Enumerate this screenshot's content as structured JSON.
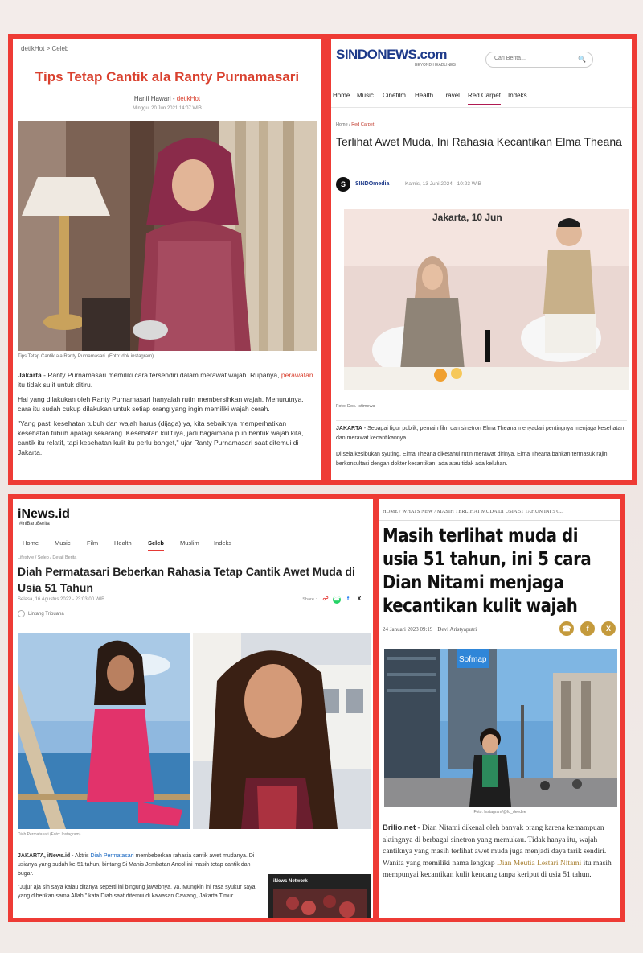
{
  "panel1": {
    "breadcrumb": "detikHot  >  Celeb",
    "title": "Tips Tetap Cantik ala Ranty Purnamasari",
    "author": "Hanif Hawari - ",
    "author_source": "detikHot",
    "date": "Minggu, 20 Jun 2021 14:07 WIB",
    "caption": "Tips Tetap Cantik ala Ranty Purnamasari. (Foto: dok instagram)",
    "p1_city": "Jakarta",
    "p1_a": " - Ranty Purnamasari memiliki cara tersendiri dalam merawat wajah. Rupanya, ",
    "p1_link": "perawatan",
    "p1_b": " itu tidak sulit untuk ditiru.",
    "p2": "Hal yang dilakukan oleh Ranty Purnamasari hanyalah rutin membersihkan wajah. Menurutnya, cara itu sudah cukup dilakukan untuk setiap orang yang ingin memiliki wajah cerah.",
    "p3": "\"Yang pasti kesehatan tubuh dan wajah harus (dijaga) ya, kita sebaiknya memperhatikan kesehatan tubuh apalagi sekarang. Kesehatan kulit iya, jadi bagaimana pun bentuk wajah kita, cantik itu relatif, tapi kesehatan kulit itu perlu banget,\" ujar Ranty Purnamasari saat ditemui di Jakarta."
  },
  "panel2": {
    "logo": "SINDONEWS.com",
    "tagline": "BEYOND HEADLINES",
    "search_placeholder": "Cari Berita...",
    "nav": [
      "Home",
      "Music",
      "Cinefilm",
      "Health",
      "Travel",
      "Red Carpet",
      "Indeks"
    ],
    "breadcrumb_home": "Home / ",
    "breadcrumb_section": "Red Carpet",
    "title": "Terlihat Awet Muda, Ini Rahasia Kecantikan Elma Theana",
    "avatar_letter": "S",
    "author": "SINDOmedia",
    "date": "Kamis, 13 Juni 2024 - 10:23 WIB",
    "photo_text": "Jakarta, 10 Jun",
    "caption": "Foto: Doc. Istimewa",
    "p1_city": "JAKARTA",
    "p1": " - Sebagai figur publik, pemain film dan sinetron Elma Theana menyadari pentingnya menjaga kesehatan dan merawat kecantikannya.",
    "p2": "Di sela kesibukan syuting, Elma Theana diketahui rutin merawat dirinya. Elma Theana bahkan termasuk rajin berkonsultasi dengan dokter kecantikan, ada atau tidak ada keluhan."
  },
  "panel3": {
    "logo": "iNews.id",
    "tag": "#iniBaruBerita",
    "nav": [
      "Home",
      "Music",
      "Film",
      "Health",
      "Seleb",
      "Muslim",
      "Indeks"
    ],
    "breadcrumb": "Lifestyle  /  Seleb  /  Detail Berita",
    "title": "Diah Permatasari Beberkan Rahasia Tetap Cantik Awet Muda di Usia 51 Tahun",
    "date": "Selasa, 16 Agustus 2022 - 23:03:00 WIB",
    "share_label": "Share :",
    "author": "Lintang Tribuana",
    "caption": "Diah Permatasari (Foto: Instagram)",
    "p1_city": "JAKARTA, iNews.id",
    "p1_a": " - Aktris ",
    "p1_link": "Diah Permatasari",
    "p1_b": " membeberkan rahasia cantik awet mudanya. Di usianya yang sudah ke-51 tahun, bintang Si Manis Jembatan Ancol ini masih tetap cantik dan bugar.",
    "p2": "\"Jujur aja sih saya kalau ditanya seperti ini bingung jawabnya, ya. Mungkin ini rasa syukur saya yang diberikan sama Allah,\" kata Diah saat ditemui di kawasan Cawang, Jakarta Timur.",
    "side_label": "iNews Network"
  },
  "panel4": {
    "breadcrumb": "HOME  /  WHATS NEW  /  MASIH TERLIHAT MUDA DI USIA 51 TAHUN INI 5 C...",
    "title": "Masih terlihat muda di usia 51 tahun, ini 5 cara Dian Nitami menjaga kecantikan kulit wajah",
    "date": "24 Januari 2023 09:19",
    "author": "Devi Aristyaputri",
    "photo_sign": "Sofmap",
    "caption": "Foto: Instagram/@fu_deedee",
    "src": "Brilio.net",
    "p_a": " - Dian Nitami dikenal oleh banyak orang karena kemampuan aktingnya di berbagai sinetron yang memukau. Tidak hanya itu, wajah cantiknya yang masih terlihat awet muda juga menjadi daya tarik sendiri. Wanita yang memiliki nama lengkap ",
    "p_link": "Dian Meutia Lestari Nitami",
    "p_b": " itu masih mempunyai kecantikan kulit kencang tanpa keriput di usia 51 tahun."
  }
}
